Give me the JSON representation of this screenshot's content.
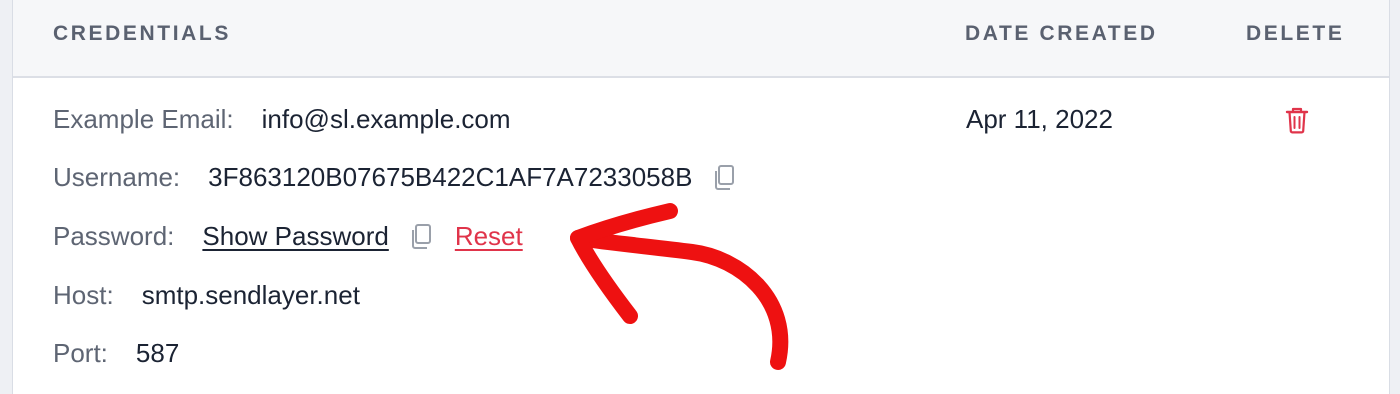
{
  "table": {
    "headers": {
      "credentials": "CREDENTIALS",
      "date_created": "DATE CREATED",
      "delete": "DELETE"
    }
  },
  "row": {
    "example_email": {
      "label": "Example Email:",
      "value": "info@sl.example.com"
    },
    "username": {
      "label": "Username:",
      "value": "3F863120B07675B422C1AF7A7233058B"
    },
    "password": {
      "label": "Password:",
      "show_label": "Show Password",
      "reset_label": "Reset"
    },
    "host": {
      "label": "Host:",
      "value": "smtp.sendlayer.net"
    },
    "port": {
      "label": "Port:",
      "value": "587"
    },
    "date_created": "Apr 11, 2022"
  },
  "icons": {
    "copy": "copy-icon",
    "trash": "trash-icon",
    "annotation": "red-arrow-annotation"
  },
  "colors": {
    "accent_red": "#e0344a",
    "arrow_red": "#ee1111",
    "text": "#1b2333",
    "label": "#5e6573"
  }
}
